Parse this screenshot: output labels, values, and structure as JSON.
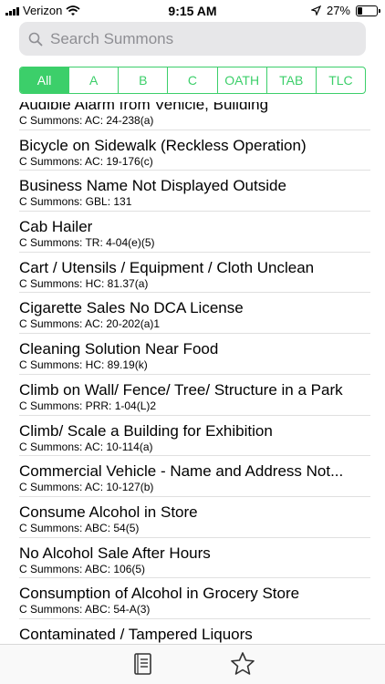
{
  "status_bar": {
    "carrier": "Verizon",
    "time": "9:15 AM",
    "battery": "27%",
    "battery_level": 0.27
  },
  "search": {
    "placeholder": "Search Summons",
    "value": ""
  },
  "filters": [
    {
      "label": "All",
      "active": true
    },
    {
      "label": "A",
      "active": false
    },
    {
      "label": "B",
      "active": false
    },
    {
      "label": "C",
      "active": false
    },
    {
      "label": "OATH",
      "active": false
    },
    {
      "label": "TAB",
      "active": false
    },
    {
      "label": "TLC",
      "active": false
    }
  ],
  "list": {
    "items": [
      {
        "title": "Audible Alarm from Vehicle, Building",
        "subtitle": "C Summons: AC: 24-238(a)"
      },
      {
        "title": "Bicycle on Sidewalk (Reckless Operation)",
        "subtitle": "C Summons: AC: 19-176(c)"
      },
      {
        "title": "Business Name Not Displayed Outside",
        "subtitle": "C Summons: GBL: 131"
      },
      {
        "title": "Cab Hailer",
        "subtitle": "C Summons: TR: 4-04(e)(5)"
      },
      {
        "title": "Cart / Utensils / Equipment / Cloth Unclean",
        "subtitle": "C Summons: HC: 81.37(a)"
      },
      {
        "title": "Cigarette Sales No DCA License",
        "subtitle": "C Summons: AC: 20-202(a)1"
      },
      {
        "title": "Cleaning Solution Near Food",
        "subtitle": "C Summons: HC: 89.19(k)"
      },
      {
        "title": "Climb on Wall/ Fence/ Tree/ Structure in a Park",
        "subtitle": "C Summons: PRR: 1-04(L)2"
      },
      {
        "title": "Climb/ Scale a Building for Exhibition",
        "subtitle": "C Summons: AC: 10-114(a)"
      },
      {
        "title": "Commercial Vehicle - Name and Address Not...",
        "subtitle": "C Summons: AC: 10-127(b)"
      },
      {
        "title": "Consume Alcohol in Store",
        "subtitle": "C Summons: ABC: 54(5)"
      },
      {
        "title": "No Alcohol Sale After Hours",
        "subtitle": "C Summons: ABC: 106(5)"
      },
      {
        "title": "Consumption of Alcohol in Grocery Store",
        "subtitle": "C Summons: ABC: 54-A(3)"
      },
      {
        "title": "Contaminated / Tampered Liquors",
        "subtitle": ""
      }
    ]
  },
  "tab_bar": {
    "tabs": [
      {
        "icon": "notebook-icon",
        "selected": true
      },
      {
        "icon": "star-icon",
        "selected": false
      }
    ]
  },
  "colors": {
    "accent": "#3ccf6a",
    "search_bg": "#e7e7e9",
    "placeholder": "#8e8e93"
  }
}
